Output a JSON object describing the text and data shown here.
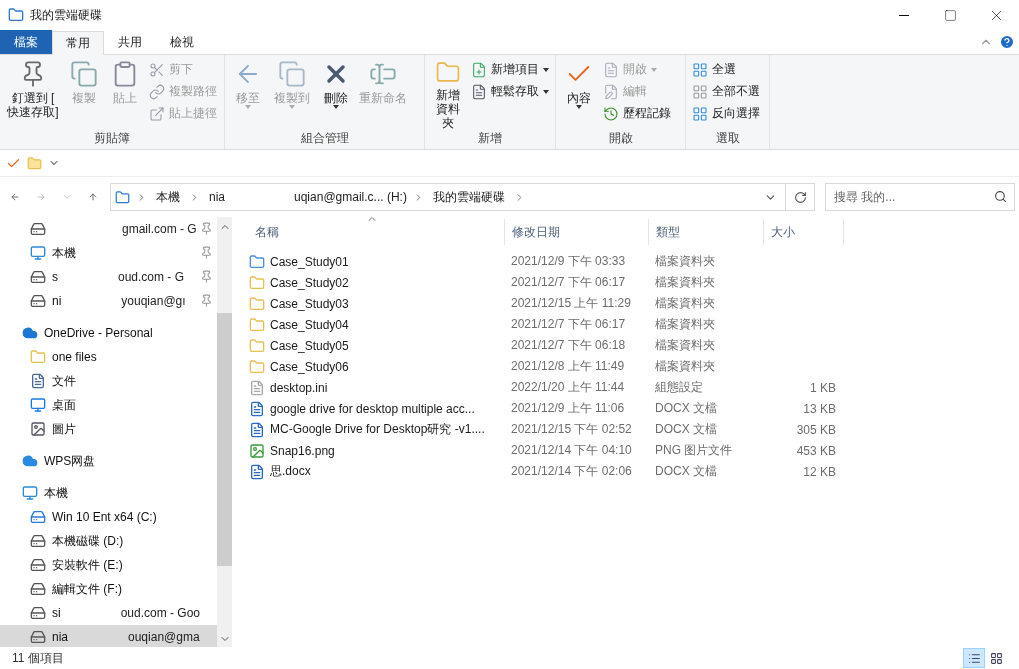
{
  "window": {
    "title": "我的雲端硬碟"
  },
  "ribbon_tabs": [
    {
      "label": "檔案",
      "kind": "file",
      "selected": false
    },
    {
      "label": "常用",
      "kind": "tab",
      "selected": true
    },
    {
      "label": "共用",
      "kind": "tab",
      "selected": false
    },
    {
      "label": "檢視",
      "kind": "tab",
      "selected": false
    }
  ],
  "ribbon_groups": [
    {
      "title": "剪貼簿",
      "buttons": [
        {
          "kind": "large",
          "label": "釘選到 [ 快速存取]",
          "disabled": false,
          "dropdown": false
        },
        {
          "kind": "large",
          "label": "複製",
          "disabled": true,
          "dropdown": false
        },
        {
          "kind": "large",
          "label": "貼上",
          "disabled": true,
          "dropdown": false
        },
        {
          "kind": "stack",
          "items": [
            {
              "label": "剪下",
              "disabled": true,
              "dropdown": false
            },
            {
              "label": "複製路徑",
              "disabled": true,
              "dropdown": false
            },
            {
              "label": "貼上捷徑",
              "disabled": true,
              "dropdown": false
            }
          ]
        }
      ]
    },
    {
      "title": "組合管理",
      "buttons": [
        {
          "kind": "large",
          "label": "移至",
          "disabled": true,
          "dropdown": true
        },
        {
          "kind": "large",
          "label": "複製到",
          "disabled": true,
          "dropdown": true
        },
        {
          "kind": "large",
          "label": "刪除",
          "disabled": false,
          "dropdown": true
        },
        {
          "kind": "large",
          "label": "重新命名",
          "disabled": true,
          "dropdown": false
        }
      ]
    },
    {
      "title": "新增",
      "buttons": [
        {
          "kind": "large",
          "label": "新增資料夾",
          "disabled": false,
          "dropdown": false
        },
        {
          "kind": "stack",
          "items": [
            {
              "label": "新增項目",
              "disabled": false,
              "dropdown": true
            },
            {
              "label": "輕鬆存取",
              "disabled": false,
              "dropdown": true
            }
          ]
        }
      ]
    },
    {
      "title": "開啟",
      "buttons": [
        {
          "kind": "large",
          "label": "內容",
          "disabled": false,
          "dropdown": true
        },
        {
          "kind": "stack",
          "items": [
            {
              "label": "開啟",
              "disabled": true,
              "dropdown": true
            },
            {
              "label": "編輯",
              "disabled": true,
              "dropdown": false
            },
            {
              "label": "歷程記錄",
              "disabled": false,
              "dropdown": false
            }
          ]
        }
      ]
    },
    {
      "title": "選取",
      "buttons": [
        {
          "kind": "stack",
          "items": [
            {
              "label": "全選",
              "disabled": false,
              "dropdown": false
            },
            {
              "label": "全部不選",
              "disabled": false,
              "dropdown": false
            },
            {
              "label": "反向選擇",
              "disabled": false,
              "dropdown": false
            }
          ]
        }
      ]
    }
  ],
  "address": {
    "crumbs": [
      {
        "label": "本機"
      },
      {
        "label": "nia",
        "tail": "uqian@gmail.c... (H:)"
      },
      {
        "label": "我的雲端硬碟"
      }
    ]
  },
  "search": {
    "placeholder": "搜尋 我的..."
  },
  "sidebar": {
    "quick_access": [
      {
        "kind": "drive",
        "tail": "gmail.com - G",
        "pinned": true,
        "selected": false
      },
      {
        "kind": "pc",
        "label": "本機",
        "pinned": true,
        "selected": false
      },
      {
        "kind": "drive",
        "label": "s",
        "tail": "oud.com - G",
        "pinned": true,
        "selected": false
      },
      {
        "kind": "drive",
        "label": "ni",
        "tail": "youqian@gı",
        "pinned": true,
        "selected": false
      }
    ],
    "items": [
      {
        "kind": "onedrive",
        "label": "OneDrive - Personal",
        "selected": false,
        "children": [
          {
            "kind": "folder",
            "label": "one files",
            "selected": false
          },
          {
            "kind": "doc",
            "label": "文件",
            "selected": false
          },
          {
            "kind": "desktop",
            "label": "桌面",
            "selected": false
          },
          {
            "kind": "picture",
            "label": "圖片",
            "selected": false
          }
        ]
      },
      {
        "kind": "wps",
        "label": "WPS网盘",
        "selected": false
      },
      {
        "kind": "pc",
        "label": "本機",
        "selected": false,
        "children": [
          {
            "kind": "windrive",
            "label": "Win 10 Ent x64 (C:)",
            "selected": false
          },
          {
            "kind": "drive",
            "label": "本機磁碟 (D:)",
            "selected": false
          },
          {
            "kind": "drive",
            "label": "安裝軟件 (E:)",
            "selected": false
          },
          {
            "kind": "drive",
            "label": "編輯文件 (F:)",
            "selected": false
          },
          {
            "kind": "drive",
            "label": "si",
            "tail": "oud.com - Goo",
            "selected": false
          },
          {
            "kind": "drive",
            "label": "nia",
            "tail": "ouqian@gma",
            "selected": true
          }
        ]
      }
    ]
  },
  "table": {
    "columns": [
      "名稱",
      "修改日期",
      "類型",
      "大小"
    ],
    "rows": [
      {
        "kind": "shared",
        "name": "Case_Study01",
        "date": "2021/12/9 下午 03:33",
        "type": "檔案資料夾",
        "selected": false
      },
      {
        "kind": "cloudfolder",
        "name": "Case_Study02",
        "date": "2021/12/7 下午 06:17",
        "type": "檔案資料夾",
        "selected": false
      },
      {
        "kind": "cloudfolder",
        "name": "Case_Study03",
        "date": "2021/12/15 上午 11:29",
        "type": "檔案資料夾",
        "selected": false
      },
      {
        "kind": "cloudfolder",
        "name": "Case_Study04",
        "date": "2021/12/7 下午 06:17",
        "type": "檔案資料夾",
        "selected": false
      },
      {
        "kind": "cloudfolder",
        "name": "Case_Study05",
        "date": "2021/12/7 下午 06:18",
        "type": "檔案資料夾",
        "selected": false
      },
      {
        "kind": "cloudfolder",
        "name": "Case_Study06",
        "date": "2021/12/8 上午 11:49",
        "type": "檔案資料夾",
        "selected": false
      },
      {
        "kind": "ini",
        "name": "desktop.ini",
        "date": "2022/1/20 上午 11:44",
        "type": "組態設定",
        "size": "1 KB",
        "selected": false
      },
      {
        "kind": "docx",
        "name": "google drive for desktop multiple acc...",
        "date": "2021/12/9 上午 11:06",
        "type": "DOCX 文檔",
        "size": "13 KB",
        "selected": false
      },
      {
        "kind": "docx",
        "name": "MC-Google Drive for Desktop研究 -v1....",
        "date": "2021/12/15 下午 02:52",
        "type": "DOCX 文檔",
        "size": "305 KB",
        "selected": false
      },
      {
        "kind": "png",
        "name": "Snap16.png",
        "date": "2021/12/14 下午 04:10",
        "type": "PNG 图片文件",
        "size": "453 KB",
        "selected": false
      },
      {
        "kind": "docx",
        "name": "思.docx",
        "date": "2021/12/14 下午 02:06",
        "type": "DOCX 文檔",
        "size": "12 KB",
        "selected": false
      }
    ]
  },
  "status_bar": {
    "count": "11 個項目",
    "views": [
      {
        "kind": "details",
        "selected": true
      },
      {
        "kind": "icons",
        "selected": false
      }
    ]
  }
}
